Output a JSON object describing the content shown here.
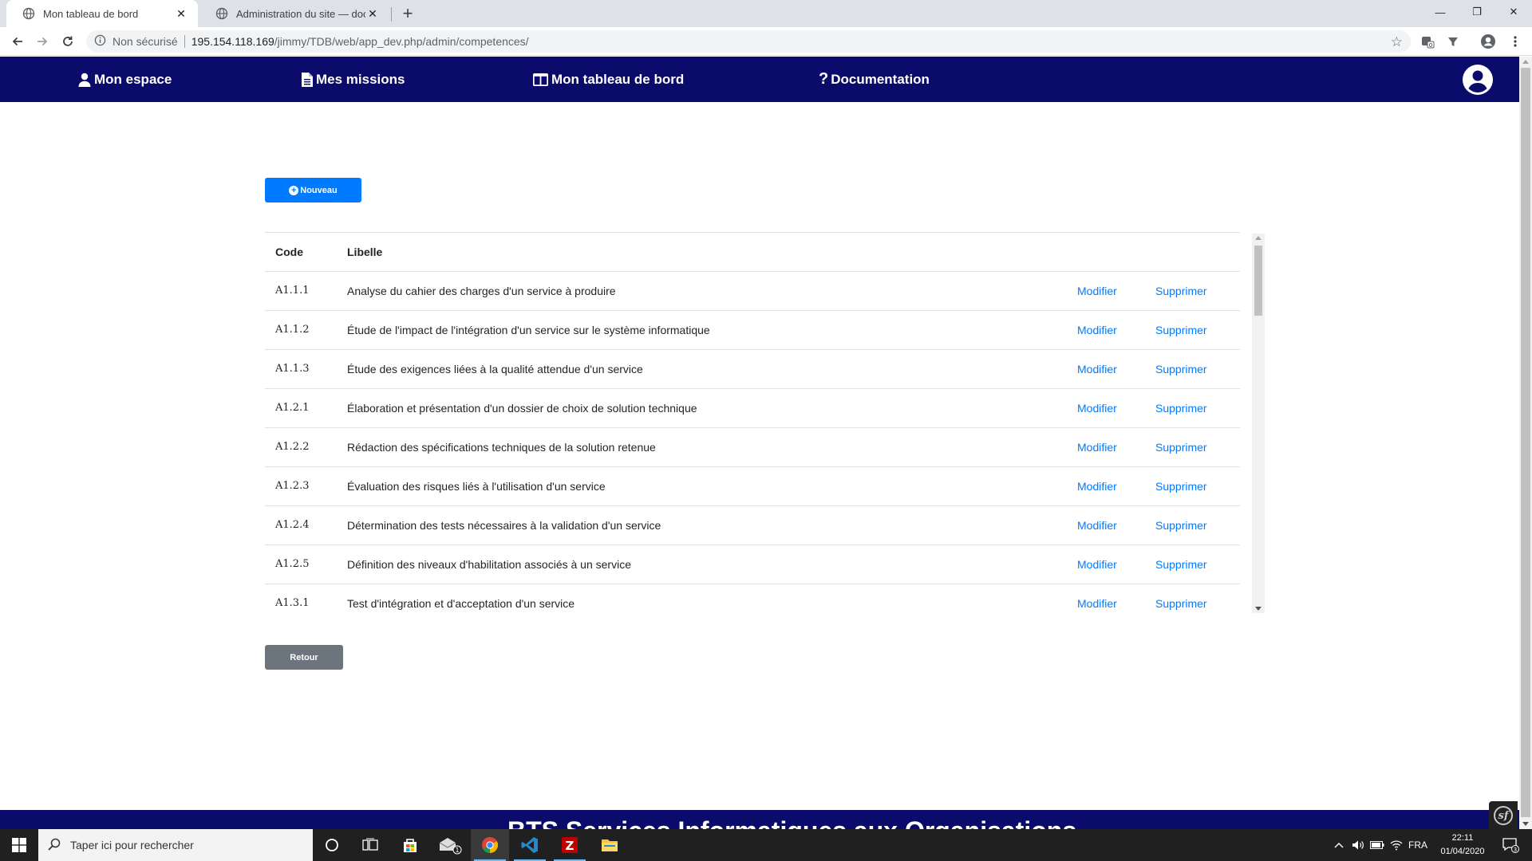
{
  "browser": {
    "tabs": [
      {
        "title": "Mon tableau de bord",
        "active": true
      },
      {
        "title": "Administration du site — docum",
        "active": false
      }
    ],
    "new_tab_glyph": "+",
    "window_controls": {
      "minimize": "—",
      "restore": "❐",
      "close": "✕"
    },
    "address": {
      "security_label": "Non sécurisé",
      "host": "195.154.118.169",
      "path": "/jimmy/TDB/web/app_dev.php/admin/competences/"
    }
  },
  "nav": {
    "items": [
      {
        "label": "Mon espace",
        "icon": "user-icon"
      },
      {
        "label": "Mes missions",
        "icon": "file-icon"
      },
      {
        "label": "Mon tableau de bord",
        "icon": "columns-icon"
      },
      {
        "label": "Documentation",
        "icon": "question-icon"
      }
    ],
    "avatar_icon": "user-circle-icon",
    "bg_color": "#0b0b6b"
  },
  "actions": {
    "new_label": "Nouveau",
    "back_label": "Retour",
    "primary_color": "#007bff",
    "secondary_color": "#6c757d"
  },
  "table": {
    "headers": {
      "code": "Code",
      "libelle": "Libelle"
    },
    "rows": [
      {
        "code": "A1.1.1",
        "libelle": "Analyse du cahier des charges d'un service à produire",
        "edit": "Modifier",
        "delete": "Supprimer"
      },
      {
        "code": "A1.1.2",
        "libelle": "Étude de l'impact de l'intégration d'un service sur le système informatique",
        "edit": "Modifier",
        "delete": "Supprimer"
      },
      {
        "code": "A1.1.3",
        "libelle": "Étude des exigences liées à la qualité attendue d'un service",
        "edit": "Modifier",
        "delete": "Supprimer"
      },
      {
        "code": "A1.2.1",
        "libelle": "Élaboration et présentation d'un dossier de choix de solution technique",
        "edit": "Modifier",
        "delete": "Supprimer"
      },
      {
        "code": "A1.2.2",
        "libelle": "Rédaction des spécifications techniques de la solution retenue",
        "edit": "Modifier",
        "delete": "Supprimer"
      },
      {
        "code": "A1.2.3",
        "libelle": "Évaluation des risques liés à l'utilisation d'un service",
        "edit": "Modifier",
        "delete": "Supprimer"
      },
      {
        "code": "A1.2.4",
        "libelle": "Détermination des tests nécessaires à la validation d'un service",
        "edit": "Modifier",
        "delete": "Supprimer"
      },
      {
        "code": "A1.2.5",
        "libelle": "Définition des niveaux d'habilitation associés à un service",
        "edit": "Modifier",
        "delete": "Supprimer"
      },
      {
        "code": "A1.3.1",
        "libelle": "Test d'intégration et d'acceptation d'un service",
        "edit": "Modifier",
        "delete": "Supprimer"
      }
    ]
  },
  "footer": {
    "text": "BTS Services Informatiques aux Organisations"
  },
  "taskbar": {
    "search_placeholder": "Taper ici pour rechercher",
    "language": "FRA",
    "time": "22:11",
    "date": "01/04/2020",
    "mail_badge": "1",
    "notification_count": "3"
  }
}
